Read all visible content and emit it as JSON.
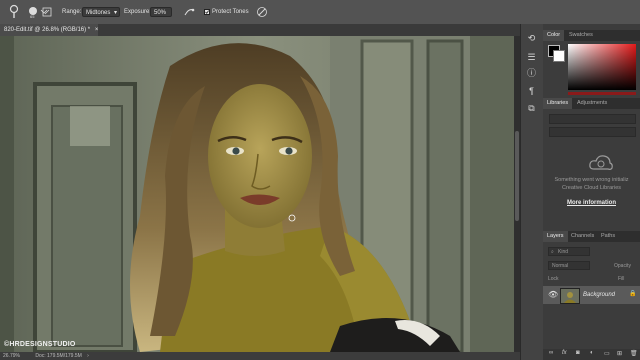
{
  "options_bar": {
    "range_label": "Range:",
    "range_value": "Midtones",
    "exposure_label": "Exposure:",
    "exposure_value": "50%",
    "protect_tones_label": "Protect Tones"
  },
  "document": {
    "tab_title": "820-Edit.tif @ 26.8% (RGB/16) *",
    "close_glyph": "×",
    "zoom": "26.79%",
    "doc_info": "Doc: 179.5M/179.5M",
    "watermark": "©HRDESIGNSTUDIO"
  },
  "color_panel": {
    "tabs": [
      "Color",
      "Swatches"
    ]
  },
  "libraries_panel": {
    "tabs": [
      "Libraries",
      "Adjustments"
    ],
    "error_line1": "Something went wrong initializ",
    "error_line2": "Creative Cloud Libraries",
    "more_info": "More information"
  },
  "layers_panel": {
    "tabs": [
      "Layers",
      "Channels",
      "Paths"
    ],
    "kind_label": "Kind",
    "blend_mode": "Normal",
    "opacity_label": "Opacity",
    "lock_label": "Lock",
    "fill_label": "Fill",
    "layer_name": "Background"
  },
  "icons": {
    "dodge_tool": "dodge-tool-icon",
    "airbrush": "airbrush-icon",
    "tablet_pressure": "tablet-pressure-icon"
  }
}
